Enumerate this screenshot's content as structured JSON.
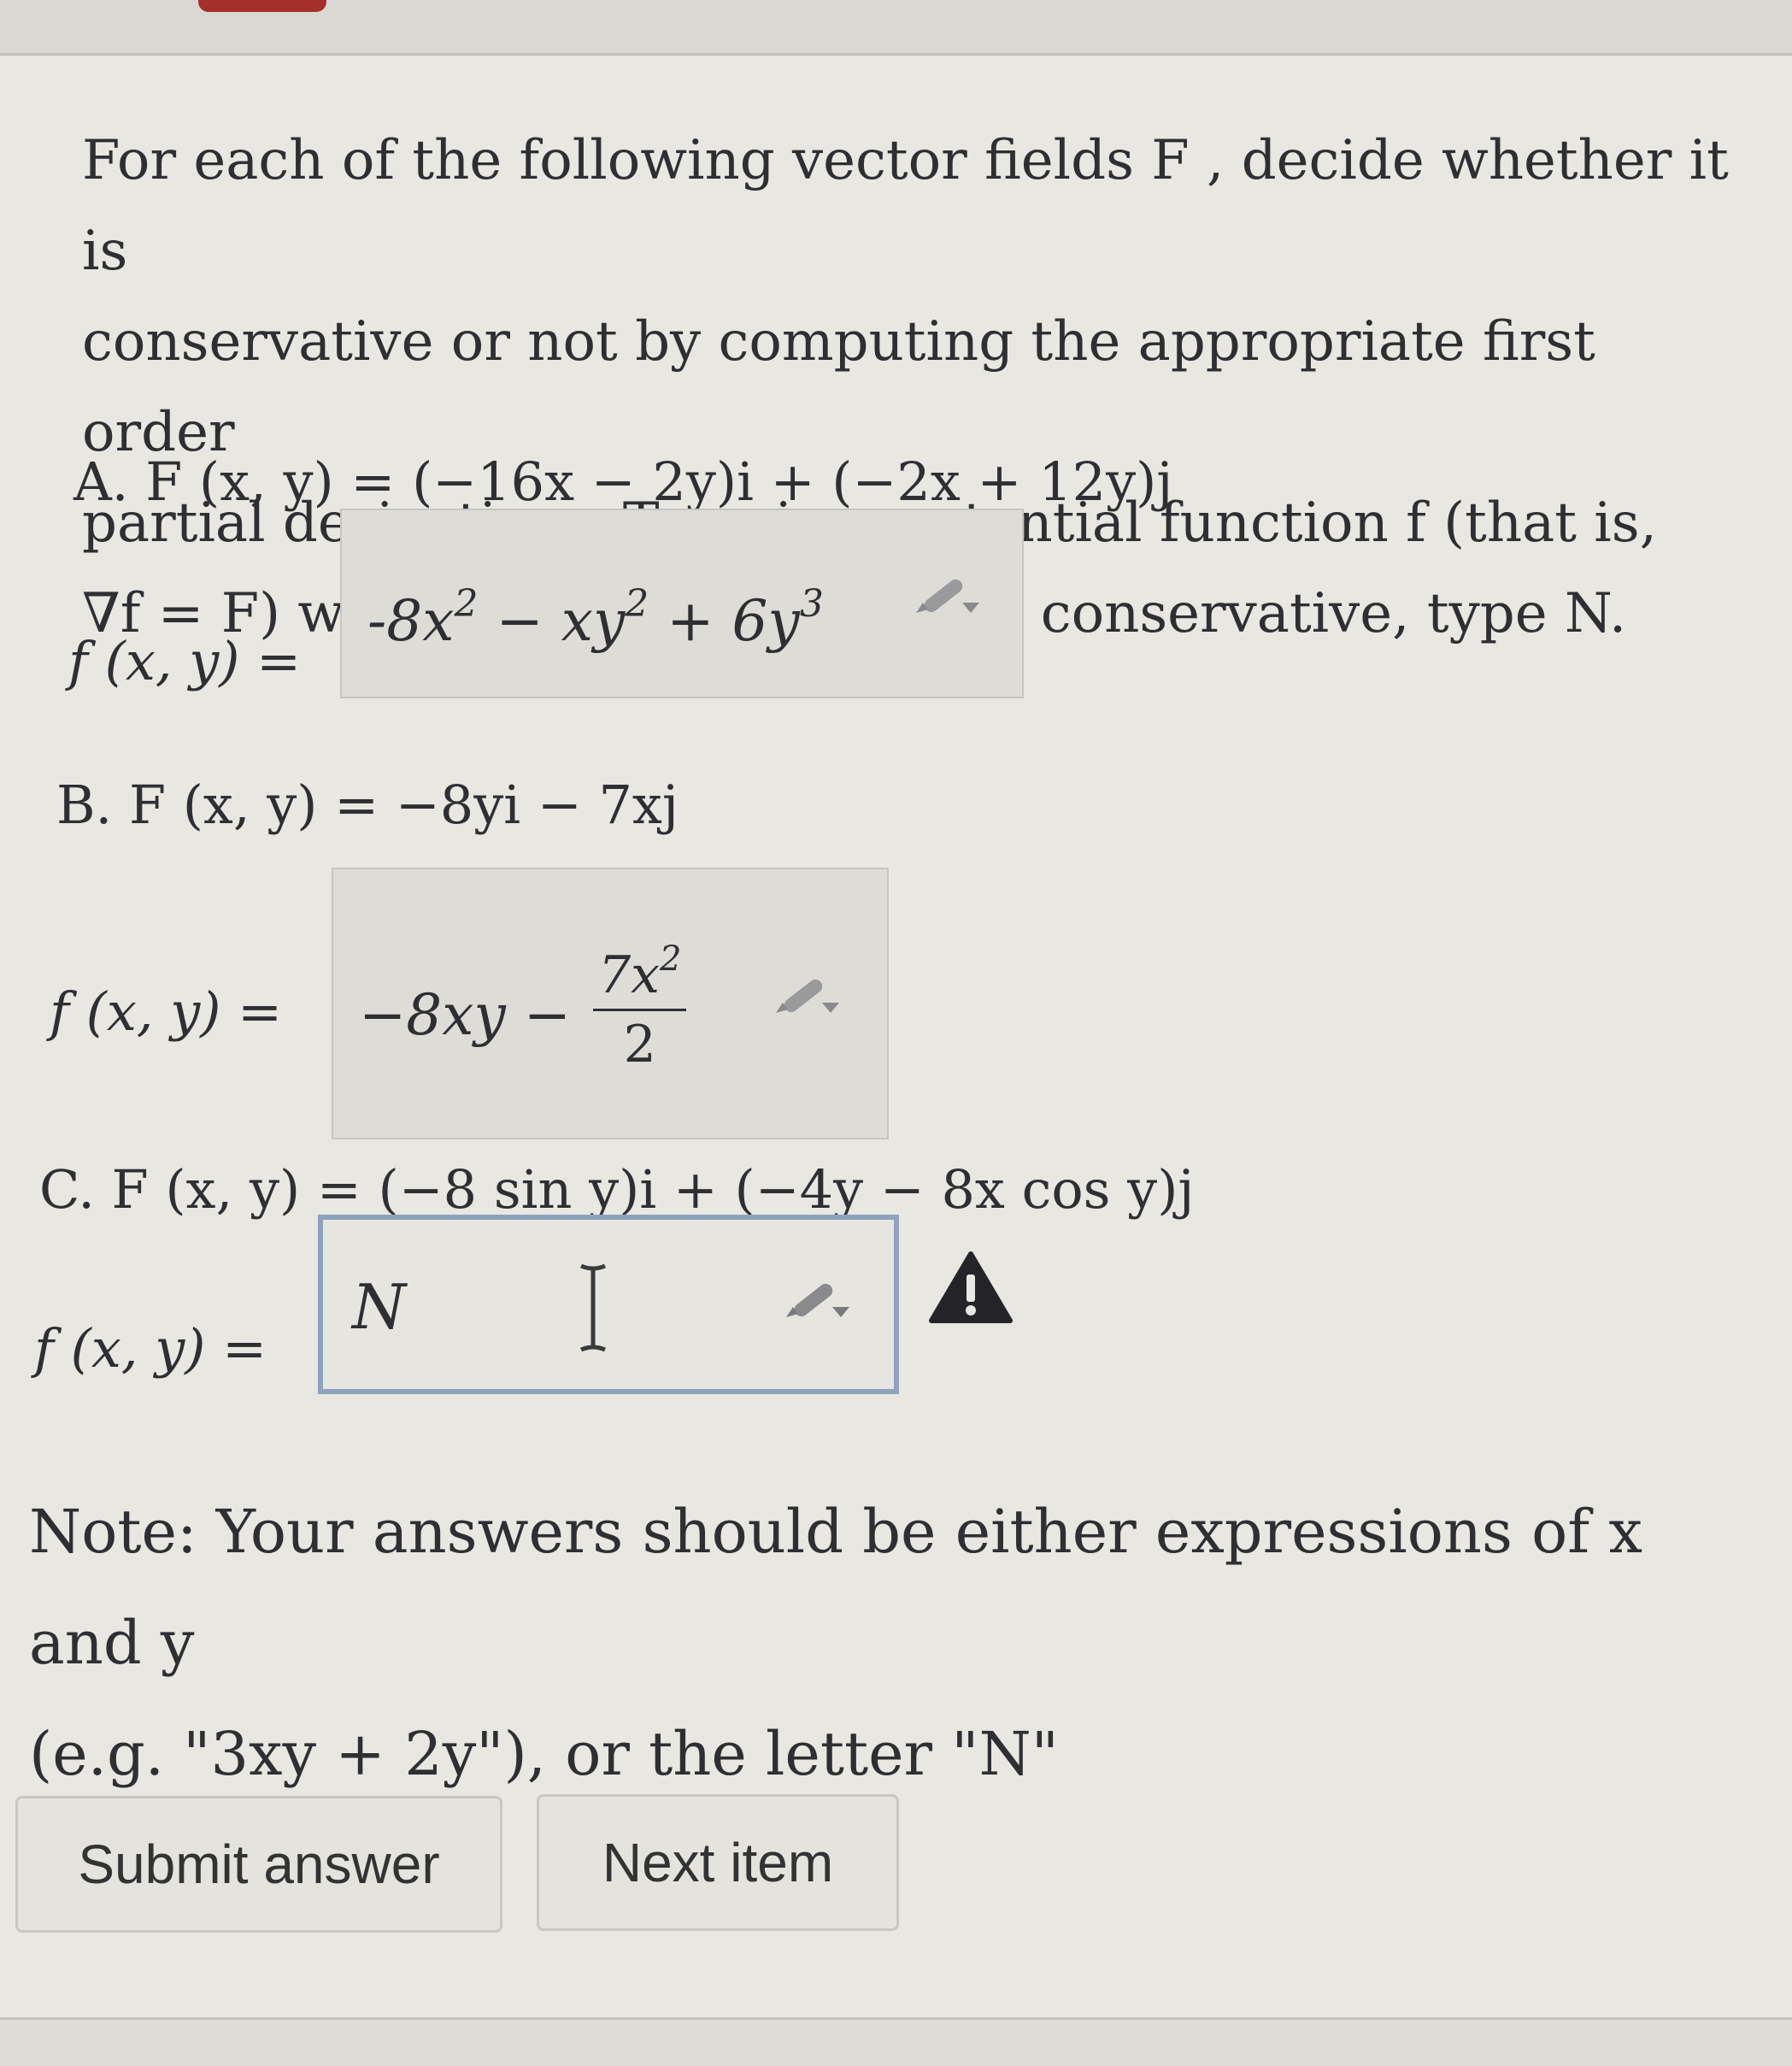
{
  "intro": {
    "line1": "For each of the following vector fields F , decide whether it is",
    "line2": "conservative or not by computing the appropriate first order",
    "line3": "partial derivatives. Type in a potential function f (that is,",
    "line4": "∇f = F) with f(0, 0) = 0. If it is not conservative, type N."
  },
  "part_a": {
    "prompt": "A. F (x, y) = (−16x − 2y)i + (−2x + 12y)j",
    "label": "f (x, y) =",
    "answer": "-8x",
    "answer_exp1": "2",
    "answer_mid": " − xy",
    "answer_exp2": "2",
    "answer_end": " + 6y",
    "answer_exp3": "3"
  },
  "part_b": {
    "prompt": "B. F (x, y) = −8yi − 7xj",
    "label": "f (x, y) =",
    "answer_lead": "−8xy −",
    "frac_num": "7x",
    "frac_num_exp": "2",
    "frac_den": "2"
  },
  "part_c": {
    "prompt": "C. F (x, y) = (−8 sin y)i + (−4y − 8x cos y)j",
    "label": "f (x, y) =",
    "answer": "N"
  },
  "note": {
    "line1": "Note: Your answers should be either expressions of x and y",
    "line2": "(e.g. \"3xy + 2y\"), or the letter \"N\""
  },
  "buttons": {
    "submit": "Submit answer",
    "next": "Next item"
  }
}
